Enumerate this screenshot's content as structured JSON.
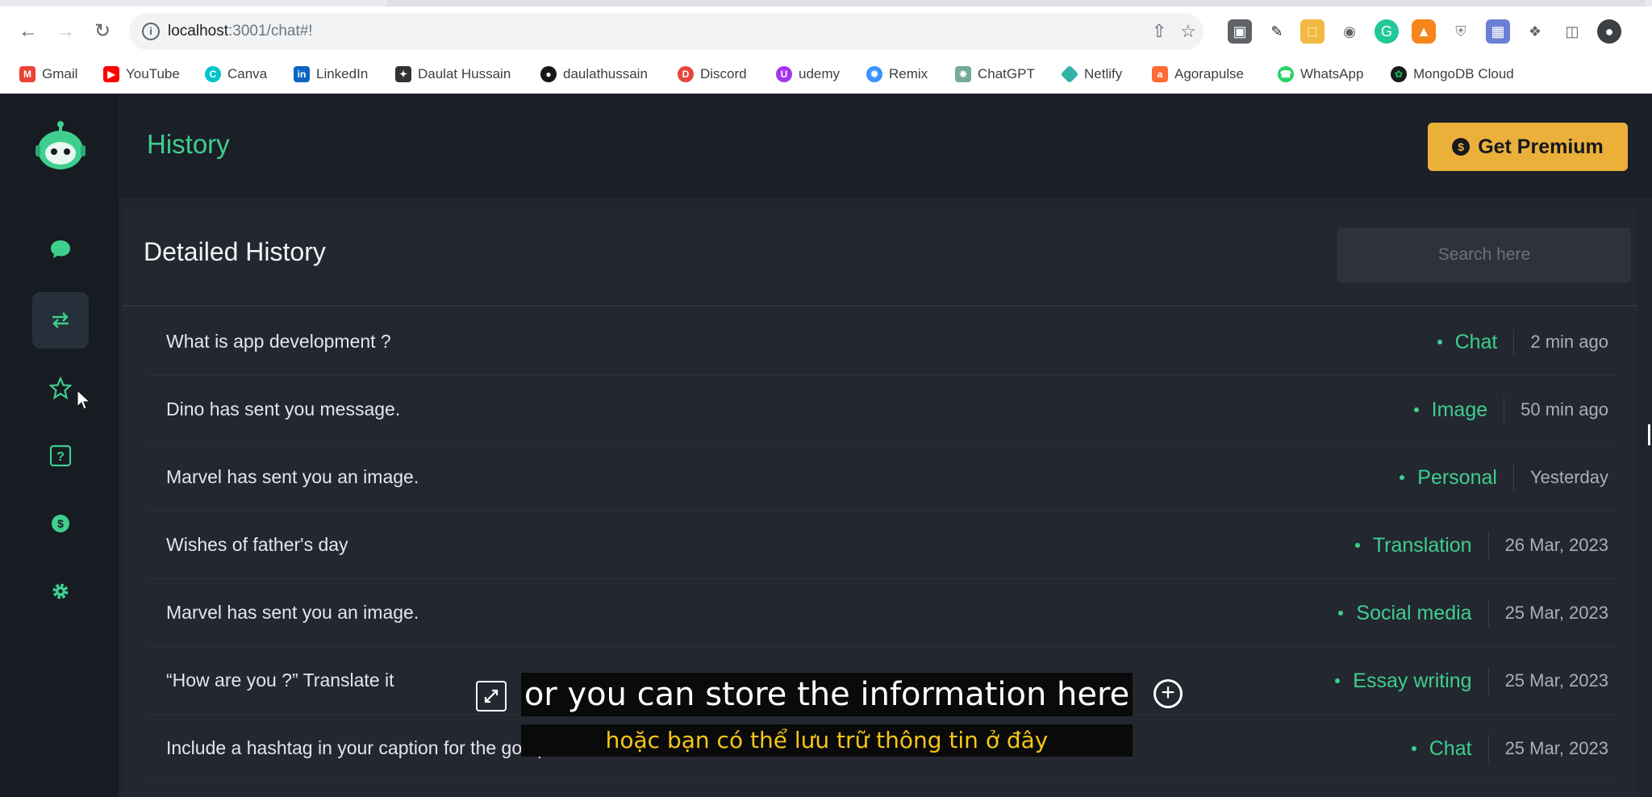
{
  "browser": {
    "url_host": "localhost",
    "url_path": ":3001/chat#!",
    "bookmarks": [
      {
        "label": "Gmail",
        "icon": "gmail-icon",
        "color": "#ea4335"
      },
      {
        "label": "YouTube",
        "icon": "youtube-icon",
        "color": "#ff0000"
      },
      {
        "label": "Canva",
        "icon": "canva-icon",
        "color": "#00c4cc"
      },
      {
        "label": "LinkedIn",
        "icon": "linkedin-icon",
        "color": "#0a66c2"
      },
      {
        "label": "Daulat Hussain",
        "icon": "bookmark-icon",
        "color": "#333333"
      },
      {
        "label": "daulathussain",
        "icon": "github-icon",
        "color": "#181717"
      },
      {
        "label": "Discord",
        "icon": "discord-icon",
        "color": "#e8453c"
      },
      {
        "label": "udemy",
        "icon": "udemy-icon",
        "color": "#a435f0"
      },
      {
        "label": "Remix",
        "icon": "remix-icon",
        "color": "#3992ff"
      },
      {
        "label": "ChatGPT",
        "icon": "chatgpt-icon",
        "color": "#74aa9c"
      },
      {
        "label": "Netlify",
        "icon": "netlify-icon",
        "color": "#32b3a7"
      },
      {
        "label": "Agorapulse",
        "icon": "agorapulse-icon",
        "color": "#ff6b35"
      },
      {
        "label": "WhatsApp",
        "icon": "whatsapp-icon",
        "color": "#25d366"
      },
      {
        "label": "MongoDB Cloud",
        "icon": "mongodb-icon",
        "color": "#13aa52"
      }
    ]
  },
  "header": {
    "title": "History",
    "premium_label": "Get Premium"
  },
  "panel": {
    "title": "Detailed History",
    "search_placeholder": "Search here"
  },
  "history": [
    {
      "text": "What is app development ?",
      "category": "Chat",
      "time": "2 min ago"
    },
    {
      "text": "Dino has sent you message.",
      "category": "Image",
      "time": "50 min ago"
    },
    {
      "text": "Marvel has sent you an image.",
      "category": "Personal",
      "time": "Yesterday"
    },
    {
      "text": "Wishes of father's day",
      "category": "Translation",
      "time": "26 Mar, 2023"
    },
    {
      "text": "Marvel has sent you an image.",
      "category": "Social media",
      "time": "25 Mar, 2023"
    },
    {
      "text": "“How are you ?” Translate it",
      "category": "Essay writing",
      "time": "25 Mar, 2023"
    },
    {
      "text": "Include a hashtag in your caption for the goa photo",
      "category": "Chat",
      "time": "25 Mar, 2023"
    }
  ],
  "captions": {
    "line1": "or you can store the information here",
    "line2": "hoặc bạn có thể lưu trữ thông tin ở đây"
  },
  "colors": {
    "accent": "#3ecf8e",
    "premium": "#eab03a",
    "caption_secondary": "#f5c518"
  }
}
